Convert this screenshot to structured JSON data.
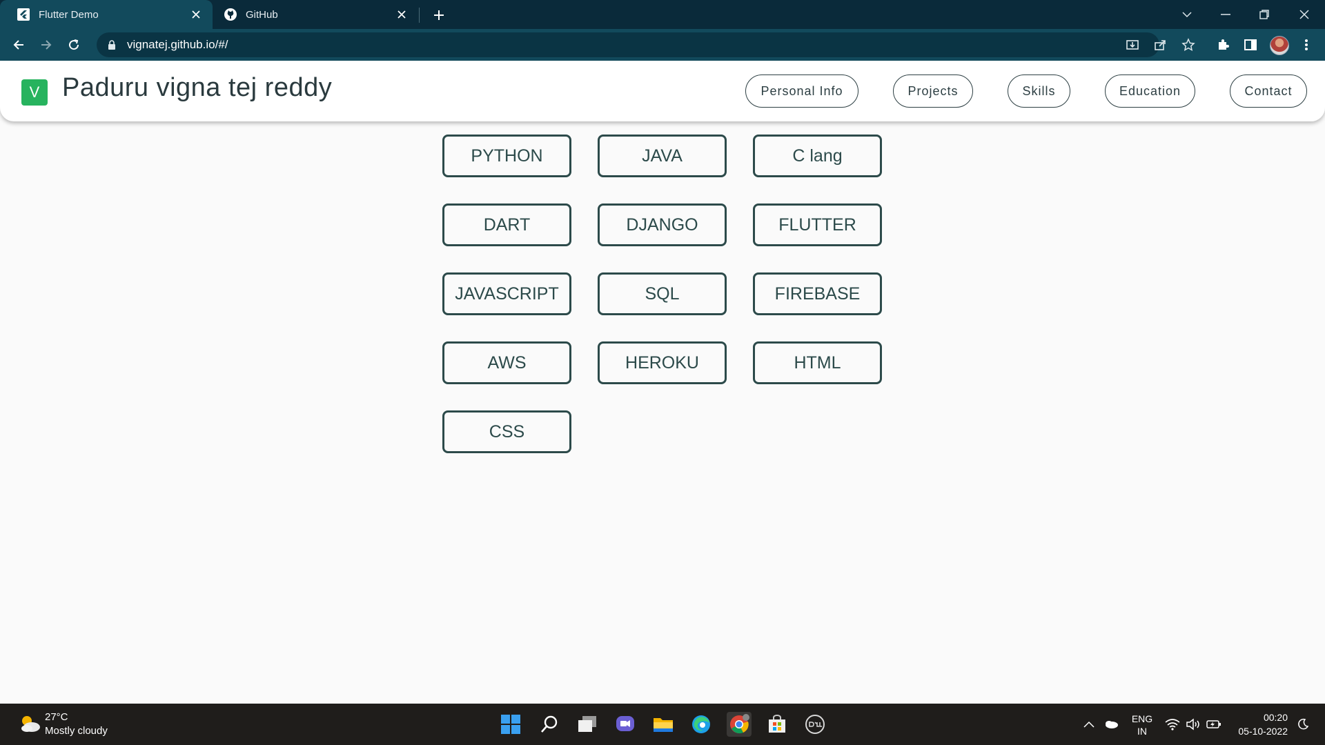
{
  "browser": {
    "tabs": [
      {
        "title": "Flutter Demo",
        "active": true
      },
      {
        "title": "GitHub",
        "active": false
      }
    ],
    "url": "vignatej.github.io/#/"
  },
  "app": {
    "logo_letter": "V",
    "title": "Paduru vigna tej reddy",
    "nav": [
      "Personal Info",
      "Projects",
      "Skills",
      "Education",
      "Contact"
    ]
  },
  "skills": [
    "PYTHON",
    "JAVA",
    "C lang",
    "DART",
    "DJANGO",
    "FLUTTER",
    "JAVASCRIPT",
    "SQL",
    "FIREBASE",
    "AWS",
    "HEROKU",
    "HTML",
    "CSS"
  ],
  "taskbar": {
    "weather_temp": "27°C",
    "weather_desc": "Mostly cloudy",
    "lang_line1": "ENG",
    "lang_line2": "IN",
    "time": "00:20",
    "date": "05-10-2022"
  },
  "colors": {
    "tabstrip": "#0a2a3a",
    "toolbar": "#124a5c",
    "logo": "#27b35e",
    "skill_border": "#2c4a4a"
  }
}
